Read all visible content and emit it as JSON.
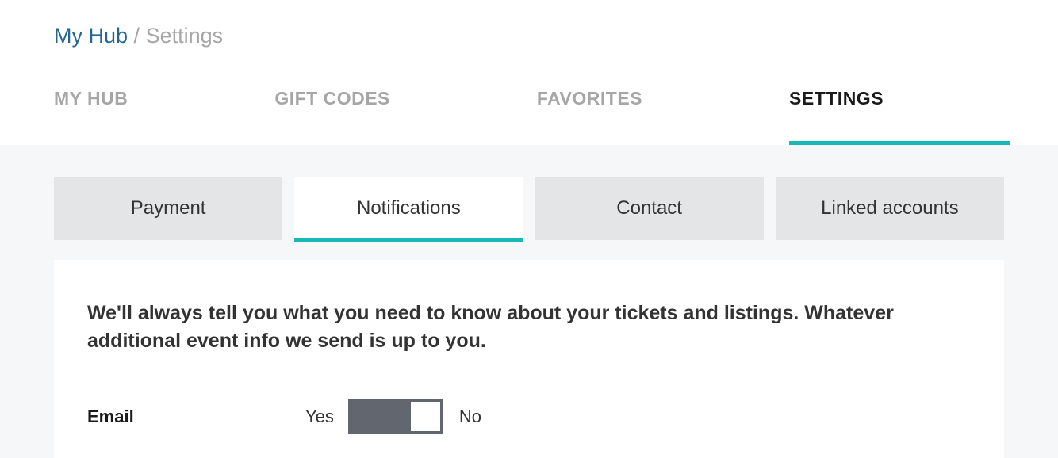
{
  "breadcrumb": {
    "link": "My Hub",
    "separator": "/",
    "current": "Settings"
  },
  "main_tabs": [
    {
      "label": "MY HUB",
      "active": false
    },
    {
      "label": "GIFT CODES",
      "active": false
    },
    {
      "label": "FAVORITES",
      "active": false
    },
    {
      "label": "SETTINGS",
      "active": true
    }
  ],
  "sub_tabs": [
    {
      "label": "Payment",
      "active": false
    },
    {
      "label": "Notifications",
      "active": true
    },
    {
      "label": "Contact",
      "active": false
    },
    {
      "label": "Linked accounts",
      "active": false
    }
  ],
  "description": "We'll always tell you what you need to know about your tickets and listings. Whatever additional event info we send is up to you.",
  "email_toggle": {
    "label": "Email",
    "yes": "Yes",
    "no": "No",
    "state": "no"
  },
  "colors": {
    "accent": "#16b8b8",
    "link": "#24668f",
    "tab_inactive_bg": "#e3e5e7",
    "gray_bg": "#f6f7f8",
    "toggle_bg": "#62676f"
  }
}
